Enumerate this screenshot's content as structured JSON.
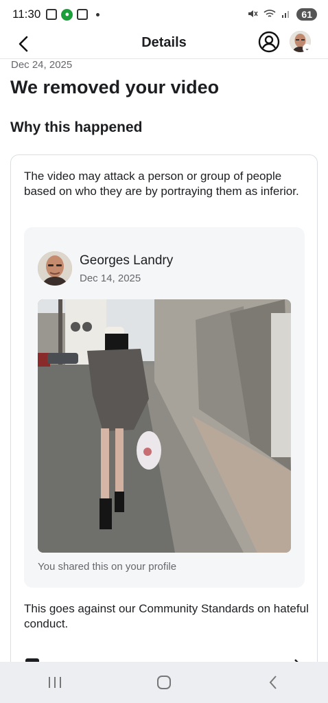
{
  "status_bar": {
    "time": "11:30",
    "battery": "61"
  },
  "header": {
    "title": "Details",
    "back_icon": "chevron-left-icon",
    "profile_icon": "person-circle-icon"
  },
  "page": {
    "date": "Dec 24, 2025",
    "heading": "We removed your video",
    "subheading": "Why this happened"
  },
  "card": {
    "description": "The video may attack a person or group of people based on who they are by portraying them as inferior.",
    "post": {
      "author": "Georges Landry",
      "date": "Dec 14, 2025",
      "footer": "You shared this on your profile"
    },
    "standards_text": "This goes against our Community Standards on hateful conduct."
  },
  "nav": {
    "recents_icon": "recents-icon",
    "home_icon": "home-icon",
    "back_icon": "back-icon"
  },
  "colors": {
    "text_primary": "#1c1e21",
    "text_secondary": "#65676b",
    "card_border": "#dadde1",
    "post_bg": "#f5f6f8"
  }
}
